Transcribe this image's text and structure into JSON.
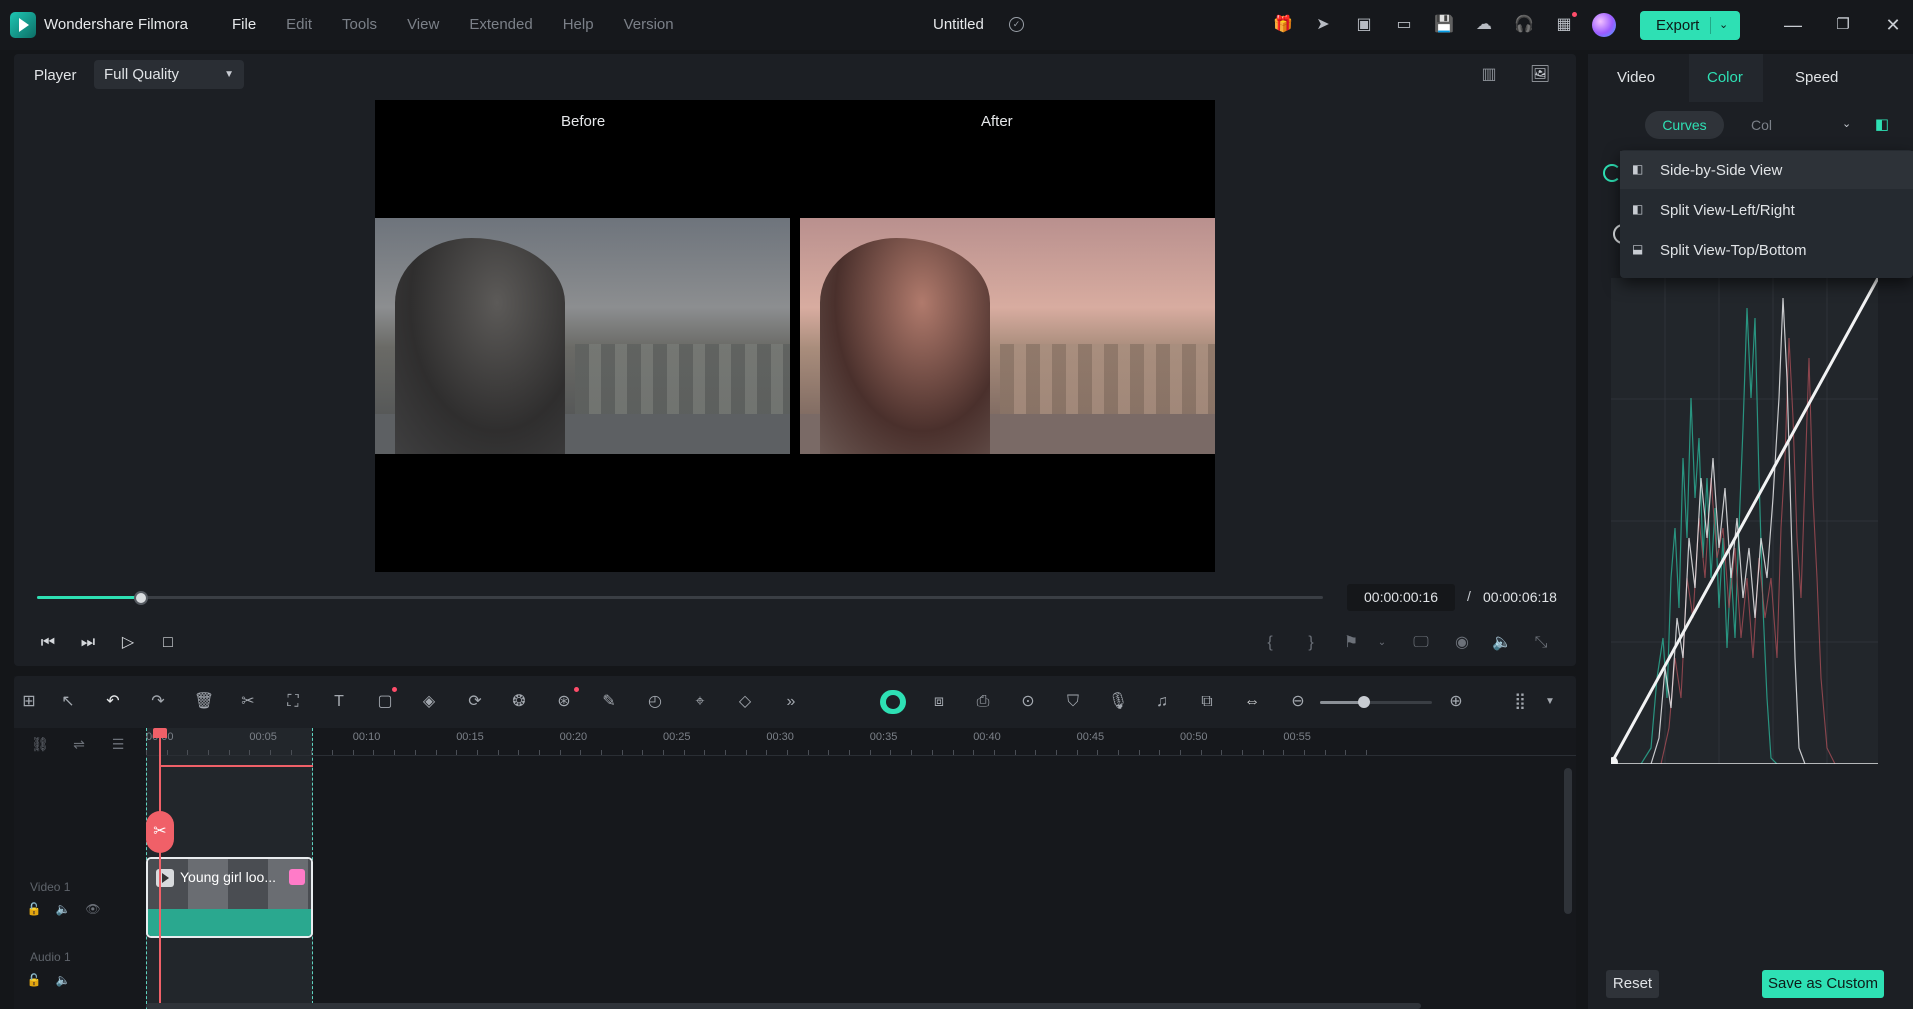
{
  "app": {
    "name": "Wondershare Filmora",
    "doc_title": "Untitled",
    "menu": [
      "File",
      "Edit",
      "Tools",
      "View",
      "Extended",
      "Help",
      "Version"
    ],
    "export_label": "Export",
    "titlebar_icons": [
      "gift-icon",
      "send-icon",
      "media-icon",
      "window-icon",
      "save-icon",
      "cloud-icon",
      "headset-icon",
      "apps-icon"
    ]
  },
  "player": {
    "label": "Player",
    "quality": "Full Quality",
    "before_label": "Before",
    "after_label": "After",
    "progress": 0.081,
    "time_current": "00:00:00:16",
    "time_sep": "/",
    "time_total": "00:00:06:18",
    "mark_in": "{",
    "mark_out": "}"
  },
  "timeline": {
    "ruler": [
      "00:00",
      "00:05",
      "00:10",
      "00:15",
      "00:20",
      "00:25",
      "00:30",
      "00:35",
      "00:40",
      "00:45",
      "00:50",
      "00:55"
    ],
    "tracks": {
      "video": "Video 1",
      "audio": "Audio 1"
    },
    "clip": {
      "name": "Young girl loo..."
    },
    "zoom": 0.39
  },
  "right_panel": {
    "tabs": [
      "Video",
      "Color",
      "Speed"
    ],
    "active_tab": "Color",
    "sub_tabs": [
      "Curves",
      "Col"
    ],
    "view_menu": [
      "Side-by-Side View",
      "Split View-Left/Right",
      "Split View-Top/Bottom"
    ],
    "selected_view": "Side-by-Side View",
    "reset_label": "Reset",
    "save_label": "Save as Custom"
  },
  "colors": {
    "accent": "#2ee0b4",
    "playhead": "#f06068",
    "background": "#141619",
    "panel": "#1c1f24"
  }
}
